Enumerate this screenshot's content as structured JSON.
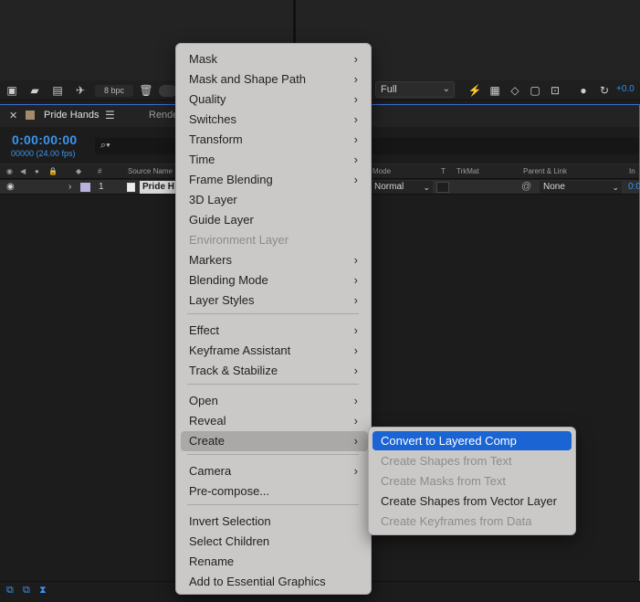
{
  "viewer": {
    "bpc_label": "8 bpc",
    "resolution": "Full",
    "exposure": "+0.0"
  },
  "timeline": {
    "tab_title": "Pride Hands",
    "render_tab": "Rende",
    "timecode": "0:00:00:00",
    "frames": "00000 (24.00 fps)",
    "columns": {
      "number": "#",
      "source_name": "Source Name",
      "mode": "Mode",
      "t": "T",
      "trkmat": "TrkMat",
      "parent": "Parent & Link",
      "in": "In"
    },
    "layer": {
      "index": "1",
      "name": "Pride H",
      "mode": "Normal",
      "parent": "None",
      "in": "0:0"
    }
  },
  "menu": {
    "items": [
      {
        "label": "Mask",
        "submenu": true,
        "disabled": false
      },
      {
        "label": "Mask and Shape Path",
        "submenu": true,
        "disabled": false
      },
      {
        "label": "Quality",
        "submenu": true,
        "disabled": false
      },
      {
        "label": "Switches",
        "submenu": true,
        "disabled": false
      },
      {
        "label": "Transform",
        "submenu": true,
        "disabled": false
      },
      {
        "label": "Time",
        "submenu": true,
        "disabled": false
      },
      {
        "label": "Frame Blending",
        "submenu": true,
        "disabled": false
      },
      {
        "label": "3D Layer",
        "submenu": false,
        "disabled": false
      },
      {
        "label": "Guide Layer",
        "submenu": false,
        "disabled": false
      },
      {
        "label": "Environment Layer",
        "submenu": false,
        "disabled": true
      },
      {
        "label": "Markers",
        "submenu": true,
        "disabled": false
      },
      {
        "label": "Blending Mode",
        "submenu": true,
        "disabled": false
      },
      {
        "label": "Layer Styles",
        "submenu": true,
        "disabled": false
      },
      {
        "label": "Effect",
        "submenu": true,
        "disabled": false
      },
      {
        "label": "Keyframe Assistant",
        "submenu": true,
        "disabled": false
      },
      {
        "label": "Track & Stabilize",
        "submenu": true,
        "disabled": false
      },
      {
        "label": "Open",
        "submenu": true,
        "disabled": false
      },
      {
        "label": "Reveal",
        "submenu": true,
        "disabled": false
      },
      {
        "label": "Create",
        "submenu": true,
        "disabled": false
      },
      {
        "label": "Camera",
        "submenu": true,
        "disabled": false
      },
      {
        "label": "Pre-compose...",
        "submenu": false,
        "disabled": false
      },
      {
        "label": "Invert Selection",
        "submenu": false,
        "disabled": false
      },
      {
        "label": "Select Children",
        "submenu": false,
        "disabled": false
      },
      {
        "label": "Rename",
        "submenu": false,
        "disabled": false
      },
      {
        "label": "Add to Essential Graphics",
        "submenu": false,
        "disabled": false
      }
    ],
    "arrow_glyph": "›"
  },
  "create_submenu": {
    "items": [
      {
        "label": "Convert to Layered Comp",
        "disabled": false,
        "selected": true
      },
      {
        "label": "Create Shapes from Text",
        "disabled": true
      },
      {
        "label": "Create Masks from Text",
        "disabled": true
      },
      {
        "label": "Create Shapes from Vector Layer",
        "disabled": false
      },
      {
        "label": "Create Keyframes from Data",
        "disabled": true
      }
    ]
  },
  "colors": {
    "accent_blue": "#3a95f0",
    "selection_blue": "#1a64d4",
    "menu_bg": "#cbc8c8"
  }
}
